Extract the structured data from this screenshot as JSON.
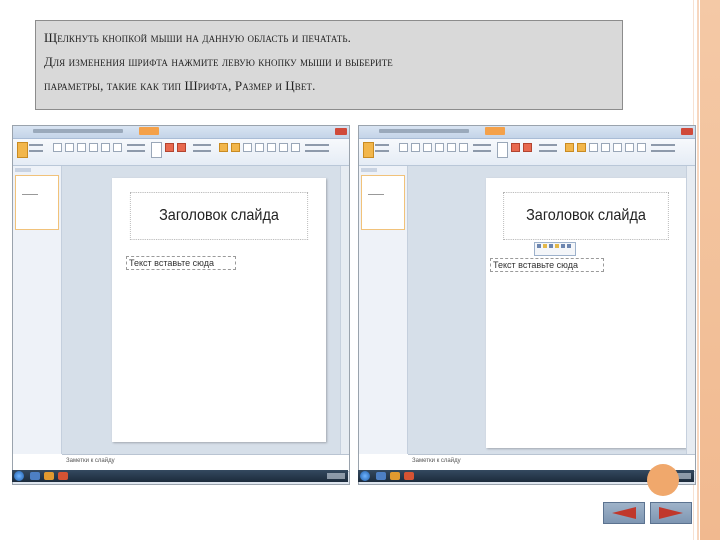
{
  "header": {
    "line1": "Щелкнуть кнопкой мыши на данную область и печатать.",
    "line2": "Для изменения шрифта нажмите левую кнопку мыши и выберите",
    "line3": "параметры, такие как тип Шрифта, Размер и Цвет."
  },
  "screenshot_left": {
    "slide_title": "Заголовок слайда",
    "text_placeholder": "Текст вставьте сюда",
    "notes_placeholder": "Заметки к слайду"
  },
  "screenshot_right": {
    "slide_title": "Заголовок слайда",
    "text_placeholder": "Текст вставьте сюда",
    "notes_placeholder": "Заметки к слайду"
  },
  "navigation": {
    "prev_icon": "arrow-left-icon",
    "next_icon": "arrow-right-icon"
  },
  "colors": {
    "accent_orange": "#f0a86c",
    "nav_blue": "#8ba2bd",
    "nav_arrow": "#c0382c"
  }
}
